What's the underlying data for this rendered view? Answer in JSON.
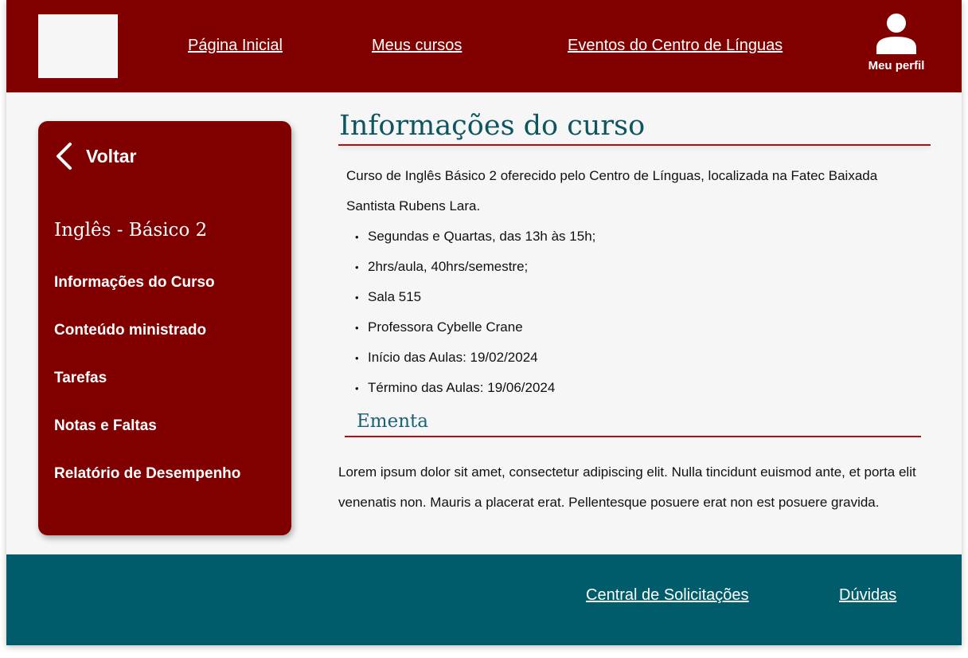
{
  "header": {
    "nav": [
      {
        "label": "Página Inicial"
      },
      {
        "label": "Meus cursos"
      },
      {
        "label": "Eventos do Centro de Línguas"
      }
    ],
    "profile_icon": "user-icon",
    "profile_label": "Meu perfil"
  },
  "sidebar": {
    "back_icon": "chevron-left-icon",
    "back_label": "Voltar",
    "course_title": "Inglês - Básico 2",
    "items": [
      {
        "label": "Informações do Curso"
      },
      {
        "label": "Conteúdo ministrado"
      },
      {
        "label": "Tarefas"
      },
      {
        "label": "Notas e Faltas"
      },
      {
        "label": "Relatório de Desempenho"
      }
    ]
  },
  "main": {
    "title": "Informações do curso",
    "intro": "Curso de Inglês Básico 2 oferecido pelo Centro de Línguas, localizada na Fatec Baixada Santista Rubens Lara.",
    "details": [
      "Segundas e Quartas, das 13h às 15h;",
      "2hrs/aula, 40hrs/semestre;",
      "Sala 515",
      "Professora Cybelle Crane",
      "Início das Aulas: 19/02/2024",
      "Término das Aulas: 19/06/2024"
    ],
    "ementa_title": "Ementa",
    "ementa_text": "Lorem ipsum dolor sit amet, consectetur adipiscing elit. Nulla tincidunt euismod ante, et porta elit venenatis non. Mauris a placerat erat. Pellentesque posuere erat non est posuere gravida."
  },
  "footer": {
    "links": [
      {
        "label": "Central de Solicitações"
      },
      {
        "label": "Dúvidas"
      }
    ]
  },
  "colors": {
    "primary": "#800000",
    "footer": "#005c6b",
    "heading": "#0f5561",
    "accent_rule": "#b01010",
    "background": "#f6f6f6"
  }
}
